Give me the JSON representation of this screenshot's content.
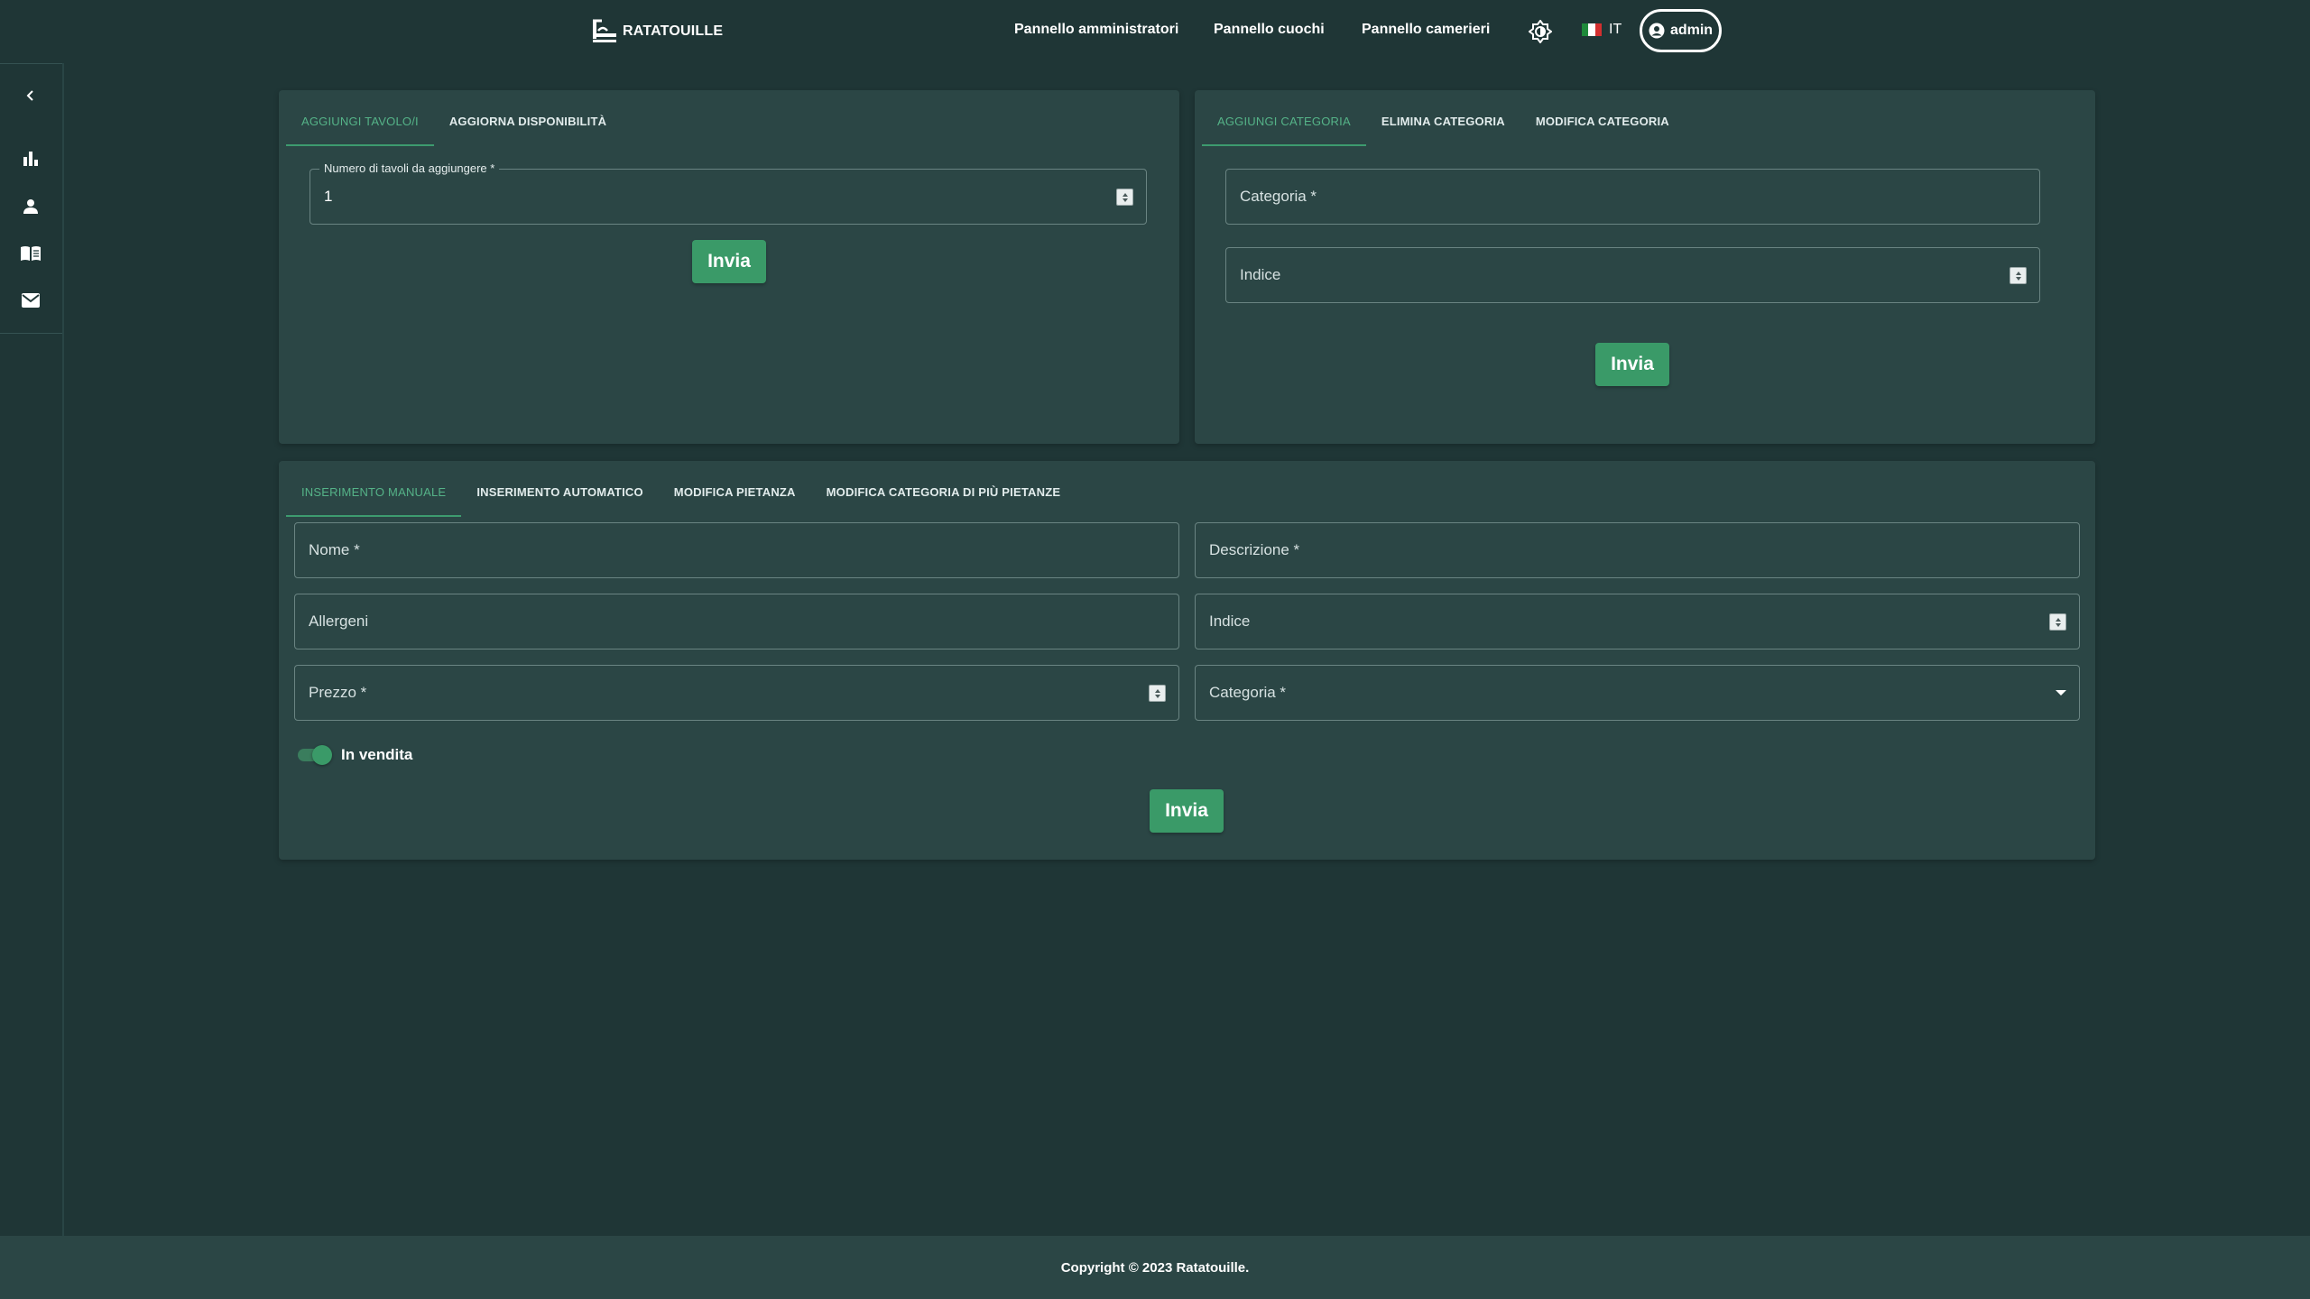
{
  "header": {
    "brand": "RATATOUILLE",
    "nav": {
      "admin_panel": "Pannello amministratori",
      "cooks_panel": "Pannello cuochi",
      "waiters_panel": "Pannello camerieri"
    },
    "language": "IT",
    "user": "admin"
  },
  "sidebar": {
    "icons": [
      "chevron-left-icon",
      "bar-chart-icon",
      "person-icon",
      "menu-book-icon",
      "mail-icon"
    ]
  },
  "tables_card": {
    "tabs": [
      "AGGIUNGI TAVOLO/I",
      "AGGIORNA DISPONIBILITÀ"
    ],
    "active_tab": 0,
    "field_label": "Numero di tavoli da aggiungere *",
    "field_value": "1",
    "submit": "Invia"
  },
  "category_card": {
    "tabs": [
      "AGGIUNGI CATEGORIA",
      "ELIMINA CATEGORIA",
      "MODIFICA CATEGORIA"
    ],
    "active_tab": 0,
    "category_placeholder": "Categoria *",
    "index_placeholder": "Indice",
    "submit": "Invia"
  },
  "dish_card": {
    "tabs": [
      "INSERIMENTO MANUALE",
      "INSERIMENTO AUTOMATICO",
      "MODIFICA PIETANZA",
      "MODIFICA CATEGORIA DI PIÙ PIETANZE"
    ],
    "active_tab": 0,
    "name_placeholder": "Nome *",
    "description_placeholder": "Descrizione *",
    "allergens_placeholder": "Allergeni",
    "index_placeholder": "Indice",
    "price_placeholder": "Prezzo *",
    "category_placeholder": "Categoria *",
    "on_sale_label": "In vendita",
    "on_sale": true,
    "submit": "Invia"
  },
  "footer": {
    "copyright": "Copyright © 2023 Ratatouille."
  },
  "colors": {
    "background": "#1f3636",
    "card": "#2b4645",
    "accent": "#3a9a68",
    "active_tab": "#55b388"
  }
}
